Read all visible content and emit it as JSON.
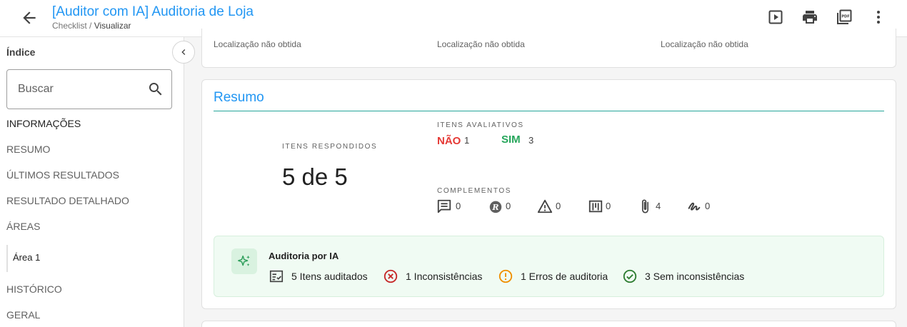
{
  "header": {
    "title": "[Auditor com IA] Auditoria de Loja",
    "breadcrumb_parent": "Checklist",
    "breadcrumb_separator": "/",
    "breadcrumb_current": "Visualizar",
    "actions": [
      "play-icon",
      "print-icon",
      "pdf-icon",
      "more-vert-icon"
    ]
  },
  "sidebar": {
    "title": "Índice",
    "search_placeholder": "Buscar",
    "items": [
      {
        "label": "INFORMAÇÕES"
      },
      {
        "label": "RESUMO"
      },
      {
        "label": "ÚLTIMOS RESULTADOS"
      },
      {
        "label": "RESULTADO DETALHADO"
      },
      {
        "label": "ÁREAS"
      },
      {
        "label": "Área 1"
      },
      {
        "label": "HISTÓRICO"
      },
      {
        "label": "GERAL"
      }
    ]
  },
  "location": {
    "values": [
      "Localização não obtida",
      "Localização não obtida",
      "Localização não obtida"
    ]
  },
  "resumo": {
    "title": "Resumo",
    "itens_respondidos_label": "ITENS RESPONDIDOS",
    "itens_respondidos_value": "5 de 5",
    "itens_avaliativos_label": "ITENS AVALIATIVOS",
    "nao_label": "NÃO",
    "nao_value": "1",
    "sim_label": "SIM",
    "sim_value": "3",
    "complementos_label": "COMPLEMENTOS",
    "complementos": [
      {
        "icon": "comment-icon",
        "value": "0"
      },
      {
        "icon": "r-badge-icon",
        "value": "0"
      },
      {
        "icon": "warning-icon",
        "value": "0"
      },
      {
        "icon": "kanban-icon",
        "value": "0"
      },
      {
        "icon": "attachment-icon",
        "value": "4"
      },
      {
        "icon": "signature-icon",
        "value": "0"
      }
    ]
  },
  "ai_audit": {
    "title": "Auditoria por IA",
    "stats": [
      {
        "icon": "checklist-icon",
        "label": "5 Itens auditados"
      },
      {
        "icon": "error-circle-icon",
        "label": "1 Inconsistências"
      },
      {
        "icon": "exclamation-circle-icon",
        "label": "1 Erros de auditoria"
      },
      {
        "icon": "check-circle-icon",
        "label": "3 Sem inconsistências"
      }
    ]
  },
  "colors": {
    "primary": "#2196f3",
    "nao": "#e53935",
    "sim": "#26a65b",
    "error": "#c62828",
    "warning": "#ef8f00",
    "success": "#2e7d32",
    "ai_background": "#f0fbf3"
  }
}
